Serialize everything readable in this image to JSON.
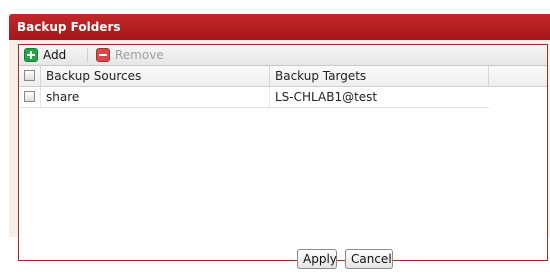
{
  "panel": {
    "title": "Backup Folders"
  },
  "toolbar": {
    "add_label": "Add",
    "remove_label": "Remove",
    "add_icon": "plus-icon",
    "remove_icon": "minus-icon",
    "remove_disabled": true
  },
  "grid": {
    "columns": [
      "Backup Sources",
      "Backup Targets"
    ],
    "rows": [
      {
        "source": "share",
        "target": "LS-CHLAB1@test",
        "checked": false
      }
    ],
    "select_all_checked": false
  },
  "footer": {
    "apply_label": "Apply",
    "cancel_label": "Cancel"
  },
  "colors": {
    "header": "#b0191d",
    "panel_bg": "#f6efe7",
    "add_icon": "#2aa24a",
    "remove_icon": "#d64a4a"
  }
}
